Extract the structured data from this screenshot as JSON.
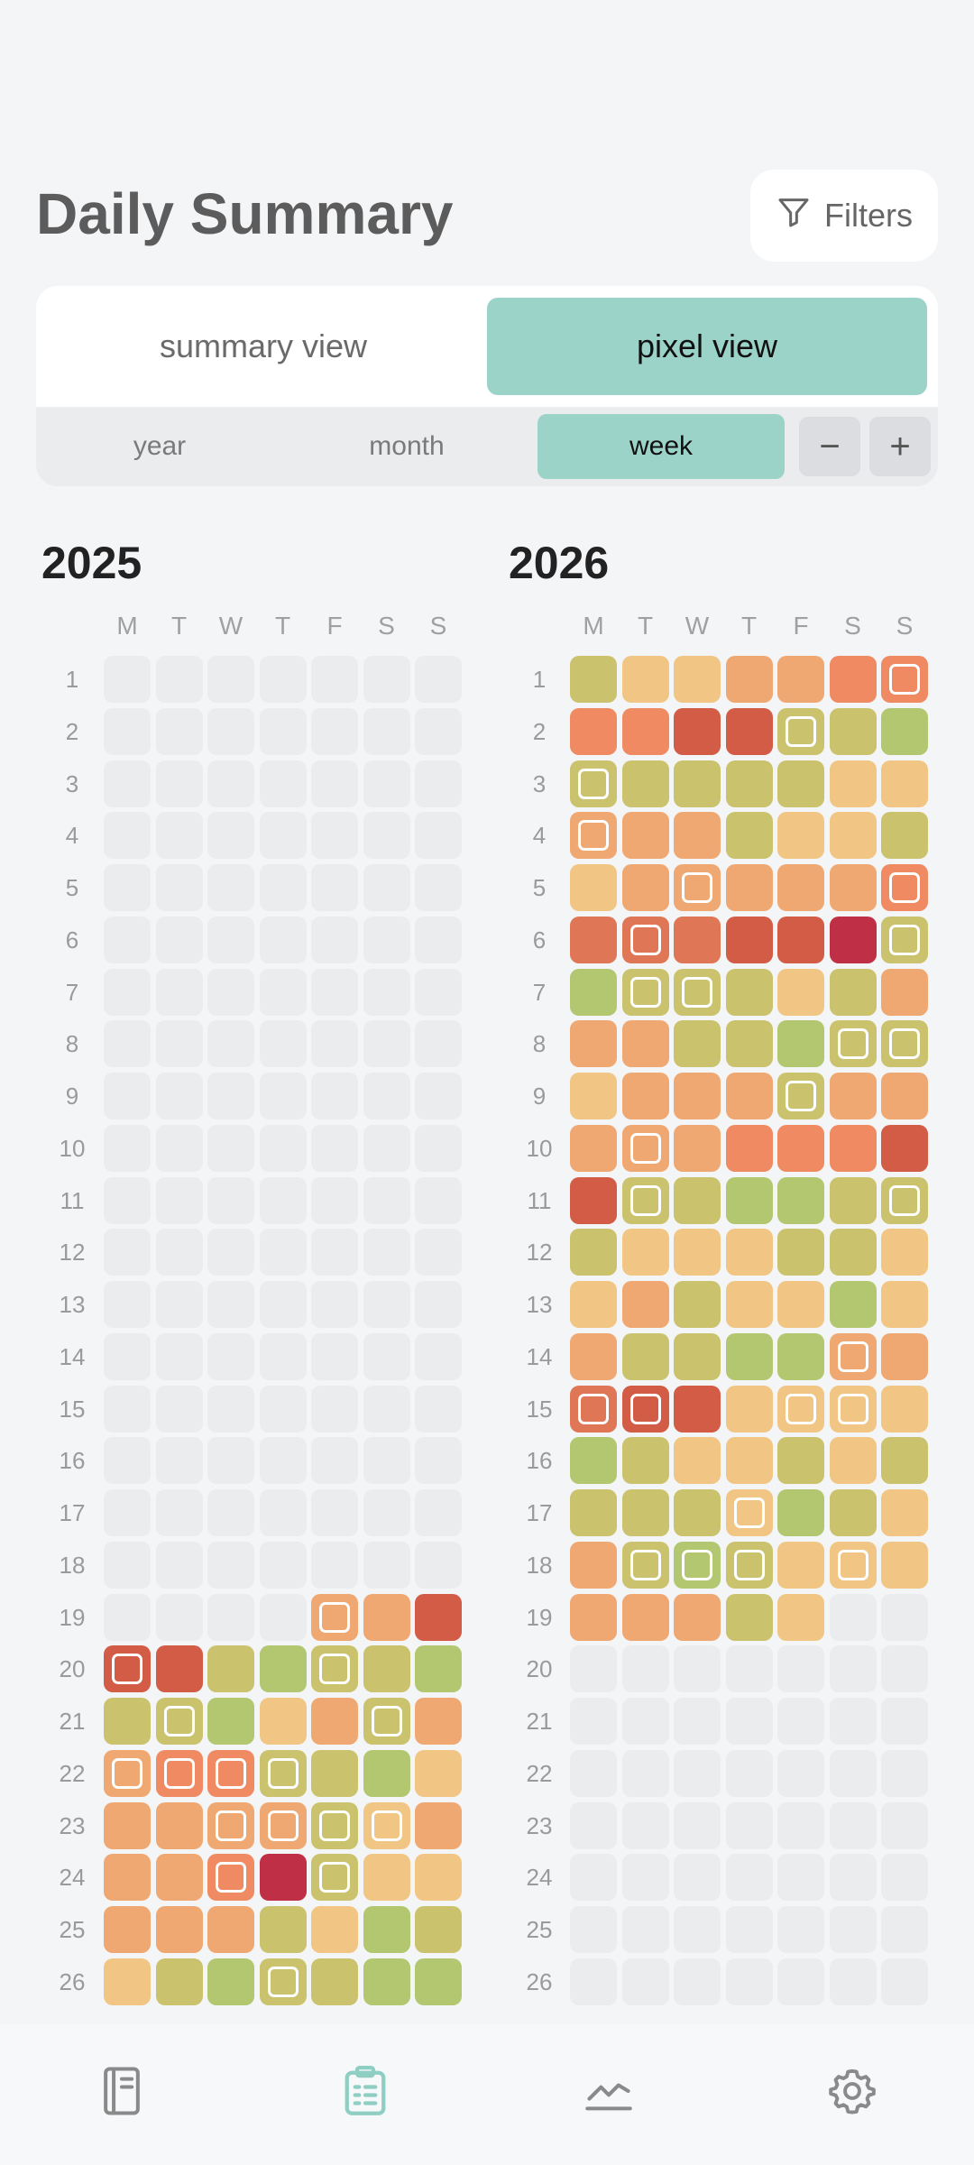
{
  "header": {
    "title": "Daily Summary",
    "filters_label": "Filters"
  },
  "view_toggle": {
    "summary": "summary view",
    "pixel": "pixel view",
    "active": "pixel"
  },
  "range_toggle": {
    "year": "year",
    "month": "month",
    "week": "week",
    "active": "week"
  },
  "zoom": {
    "minus": "−",
    "plus": "+"
  },
  "day_headers": [
    "M",
    "T",
    "W",
    "T",
    "F",
    "S",
    "S"
  ],
  "colors": {
    "0": "#ebeced",
    "1": "#bf2f45",
    "2": "#d35c46",
    "3": "#df7656",
    "4": "#ef8a62",
    "5": "#efa872",
    "6": "#f1c684",
    "7": "#cbc26e",
    "8": "#b2c770",
    "accent": "#9cd3c8"
  },
  "calendars": [
    {
      "year": "2025",
      "rows": [
        {
          "week": "1",
          "cells": [
            0,
            0,
            0,
            0,
            0,
            0,
            0
          ]
        },
        {
          "week": "2",
          "cells": [
            0,
            0,
            0,
            0,
            0,
            0,
            0
          ]
        },
        {
          "week": "3",
          "cells": [
            0,
            0,
            0,
            0,
            0,
            0,
            0
          ]
        },
        {
          "week": "4",
          "cells": [
            0,
            0,
            0,
            0,
            0,
            0,
            0
          ]
        },
        {
          "week": "5",
          "cells": [
            0,
            0,
            0,
            0,
            0,
            0,
            0
          ]
        },
        {
          "week": "6",
          "cells": [
            0,
            0,
            0,
            0,
            0,
            0,
            0
          ]
        },
        {
          "week": "7",
          "cells": [
            0,
            0,
            0,
            0,
            0,
            0,
            0
          ]
        },
        {
          "week": "8",
          "cells": [
            0,
            0,
            0,
            0,
            0,
            0,
            0
          ]
        },
        {
          "week": "9",
          "cells": [
            0,
            0,
            0,
            0,
            0,
            0,
            0
          ]
        },
        {
          "week": "10",
          "cells": [
            0,
            0,
            0,
            0,
            0,
            0,
            0
          ]
        },
        {
          "week": "11",
          "cells": [
            0,
            0,
            0,
            0,
            0,
            0,
            0
          ]
        },
        {
          "week": "12",
          "cells": [
            0,
            0,
            0,
            0,
            0,
            0,
            0
          ]
        },
        {
          "week": "13",
          "cells": [
            0,
            0,
            0,
            0,
            0,
            0,
            0
          ]
        },
        {
          "week": "14",
          "cells": [
            0,
            0,
            0,
            0,
            0,
            0,
            0
          ]
        },
        {
          "week": "15",
          "cells": [
            0,
            0,
            0,
            0,
            0,
            0,
            0
          ]
        },
        {
          "week": "16",
          "cells": [
            0,
            0,
            0,
            0,
            0,
            0,
            0
          ]
        },
        {
          "week": "17",
          "cells": [
            0,
            0,
            0,
            0,
            0,
            0,
            0
          ]
        },
        {
          "week": "18",
          "cells": [
            0,
            0,
            0,
            0,
            0,
            0,
            0
          ]
        },
        {
          "week": "19",
          "cells": [
            0,
            0,
            0,
            0,
            5,
            5,
            2
          ],
          "marked": [
            4
          ]
        },
        {
          "week": "20",
          "cells": [
            2,
            2,
            7,
            8,
            7,
            7,
            8
          ],
          "marked": [
            0,
            4
          ]
        },
        {
          "week": "21",
          "cells": [
            7,
            7,
            8,
            6,
            5,
            7,
            5
          ],
          "marked": [
            1,
            5
          ]
        },
        {
          "week": "22",
          "cells": [
            5,
            4,
            4,
            7,
            7,
            8,
            6
          ],
          "marked": [
            0,
            1,
            2,
            3
          ]
        },
        {
          "week": "23",
          "cells": [
            5,
            5,
            5,
            5,
            7,
            6,
            5
          ],
          "marked": [
            2,
            3,
            4,
            5
          ]
        },
        {
          "week": "24",
          "cells": [
            5,
            5,
            4,
            1,
            7,
            6,
            6
          ],
          "marked": [
            2,
            4
          ]
        },
        {
          "week": "25",
          "cells": [
            5,
            5,
            5,
            7,
            6,
            8,
            7
          ]
        },
        {
          "week": "26",
          "cells": [
            6,
            7,
            8,
            7,
            7,
            8,
            8
          ],
          "marked": [
            3
          ]
        }
      ]
    },
    {
      "year": "2026",
      "rows": [
        {
          "week": "1",
          "cells": [
            7,
            6,
            6,
            5,
            5,
            4,
            4
          ],
          "marked": [
            6
          ]
        },
        {
          "week": "2",
          "cells": [
            4,
            4,
            2,
            2,
            7,
            7,
            8
          ],
          "marked": [
            4
          ]
        },
        {
          "week": "3",
          "cells": [
            7,
            7,
            7,
            7,
            7,
            6,
            6
          ],
          "marked": [
            0
          ]
        },
        {
          "week": "4",
          "cells": [
            5,
            5,
            5,
            7,
            6,
            6,
            7
          ],
          "marked": [
            0
          ]
        },
        {
          "week": "5",
          "cells": [
            6,
            5,
            5,
            5,
            5,
            5,
            4
          ],
          "marked": [
            2,
            6
          ]
        },
        {
          "week": "6",
          "cells": [
            3,
            3,
            3,
            2,
            2,
            1,
            7
          ],
          "marked": [
            1,
            6
          ]
        },
        {
          "week": "7",
          "cells": [
            8,
            7,
            7,
            7,
            6,
            7,
            5
          ],
          "marked": [
            1,
            2
          ]
        },
        {
          "week": "8",
          "cells": [
            5,
            5,
            7,
            7,
            8,
            7,
            7
          ],
          "marked": [
            5,
            6
          ]
        },
        {
          "week": "9",
          "cells": [
            6,
            5,
            5,
            5,
            7,
            5,
            5
          ],
          "marked": [
            4
          ]
        },
        {
          "week": "10",
          "cells": [
            5,
            5,
            5,
            4,
            4,
            4,
            2
          ],
          "marked": [
            1
          ]
        },
        {
          "week": "11",
          "cells": [
            2,
            7,
            7,
            8,
            8,
            7,
            7
          ],
          "marked": [
            1,
            6
          ]
        },
        {
          "week": "12",
          "cells": [
            7,
            6,
            6,
            6,
            7,
            7,
            6
          ]
        },
        {
          "week": "13",
          "cells": [
            6,
            5,
            7,
            6,
            6,
            8,
            6
          ]
        },
        {
          "week": "14",
          "cells": [
            5,
            7,
            7,
            8,
            8,
            5,
            5
          ],
          "marked": [
            5
          ]
        },
        {
          "week": "15",
          "cells": [
            3,
            2,
            2,
            6,
            6,
            6,
            6
          ],
          "marked": [
            0,
            1,
            4,
            5
          ]
        },
        {
          "week": "16",
          "cells": [
            8,
            7,
            6,
            6,
            7,
            6,
            7
          ]
        },
        {
          "week": "17",
          "cells": [
            7,
            7,
            7,
            6,
            8,
            7,
            6
          ],
          "marked": [
            3
          ]
        },
        {
          "week": "18",
          "cells": [
            5,
            7,
            8,
            7,
            6,
            6,
            6
          ],
          "marked": [
            1,
            2,
            3,
            5
          ]
        },
        {
          "week": "19",
          "cells": [
            5,
            5,
            5,
            7,
            6,
            0,
            0
          ]
        },
        {
          "week": "20",
          "cells": [
            0,
            0,
            0,
            0,
            0,
            0,
            0
          ]
        },
        {
          "week": "21",
          "cells": [
            0,
            0,
            0,
            0,
            0,
            0,
            0
          ]
        },
        {
          "week": "22",
          "cells": [
            0,
            0,
            0,
            0,
            0,
            0,
            0
          ]
        },
        {
          "week": "23",
          "cells": [
            0,
            0,
            0,
            0,
            0,
            0,
            0
          ]
        },
        {
          "week": "24",
          "cells": [
            0,
            0,
            0,
            0,
            0,
            0,
            0
          ]
        },
        {
          "week": "25",
          "cells": [
            0,
            0,
            0,
            0,
            0,
            0,
            0
          ]
        },
        {
          "week": "26",
          "cells": [
            0,
            0,
            0,
            0,
            0,
            0,
            0
          ]
        }
      ]
    }
  ],
  "nav": [
    {
      "icon": "journal-icon",
      "active": false
    },
    {
      "icon": "clipboard-icon",
      "active": true
    },
    {
      "icon": "chart-icon",
      "active": false
    },
    {
      "icon": "gear-icon",
      "active": false
    }
  ]
}
